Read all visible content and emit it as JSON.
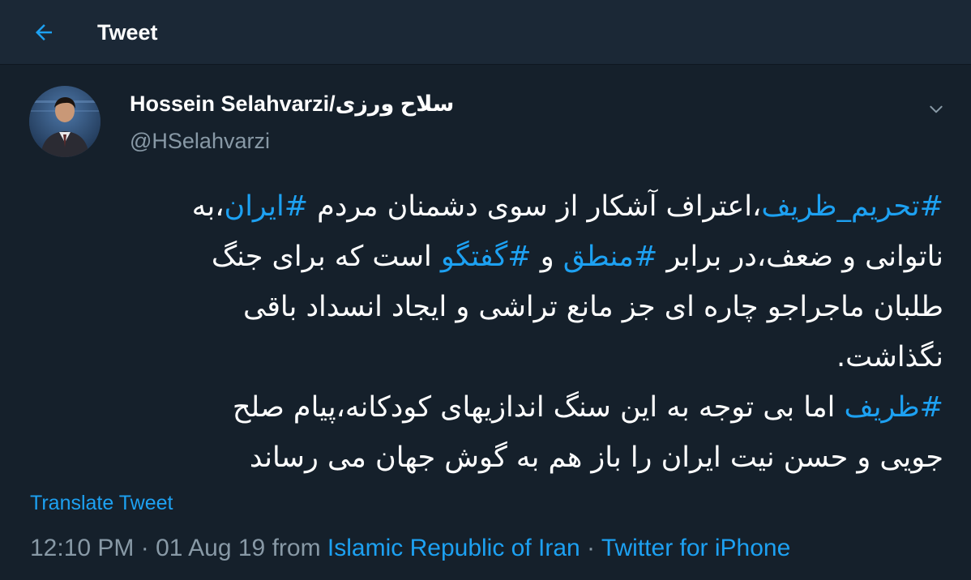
{
  "header": {
    "title": "Tweet",
    "back_icon": "arrow-left-icon"
  },
  "author": {
    "name": "Hossein Selahvarzi/سلاح ورزی",
    "handle": "@HSelahvarzi",
    "avatar": "profile-photo"
  },
  "tweet": {
    "lines": [
      [
        {
          "text": "#تحریم_ظریف",
          "tag": true
        },
        {
          "text": "،اعتراف آشکار از سوی دشمنان مردم ",
          "tag": false
        },
        {
          "text": "#ایران",
          "tag": true
        },
        {
          "text": "،به",
          "tag": false
        }
      ],
      [
        {
          "text": "ناتوانی و ضعف،در برابر ",
          "tag": false
        },
        {
          "text": "#منطق",
          "tag": true
        },
        {
          "text": " و ",
          "tag": false
        },
        {
          "text": "#گفتگو",
          "tag": true
        },
        {
          "text": " است که برای جنگ",
          "tag": false
        }
      ],
      [
        {
          "text": "طلبان ماجراجو چاره ای جز مانع تراشی و ایجاد انسداد باقی",
          "tag": false
        }
      ],
      [
        {
          "text": "نگذاشت.",
          "tag": false
        }
      ],
      [
        {
          "text": "#ظریف",
          "tag": true
        },
        {
          "text": " اما بی توجه به این سنگ اندازیهای کودکانه،پیام صلح",
          "tag": false
        }
      ],
      [
        {
          "text": "جویی و حسن نیت ایران را باز هم به گوش جهان می رساند",
          "tag": false
        }
      ]
    ]
  },
  "translate": {
    "label": "Translate Tweet"
  },
  "meta": {
    "time": "12:10 PM",
    "date": "01 Aug 19",
    "from_label": "from",
    "location": "Islamic Republic of Iran",
    "source": "Twitter for iPhone",
    "separator": " · "
  },
  "colors": {
    "background": "#15202b",
    "header_bg": "#1b2836",
    "accent": "#1da1f2",
    "secondary_text": "#8899a6"
  }
}
